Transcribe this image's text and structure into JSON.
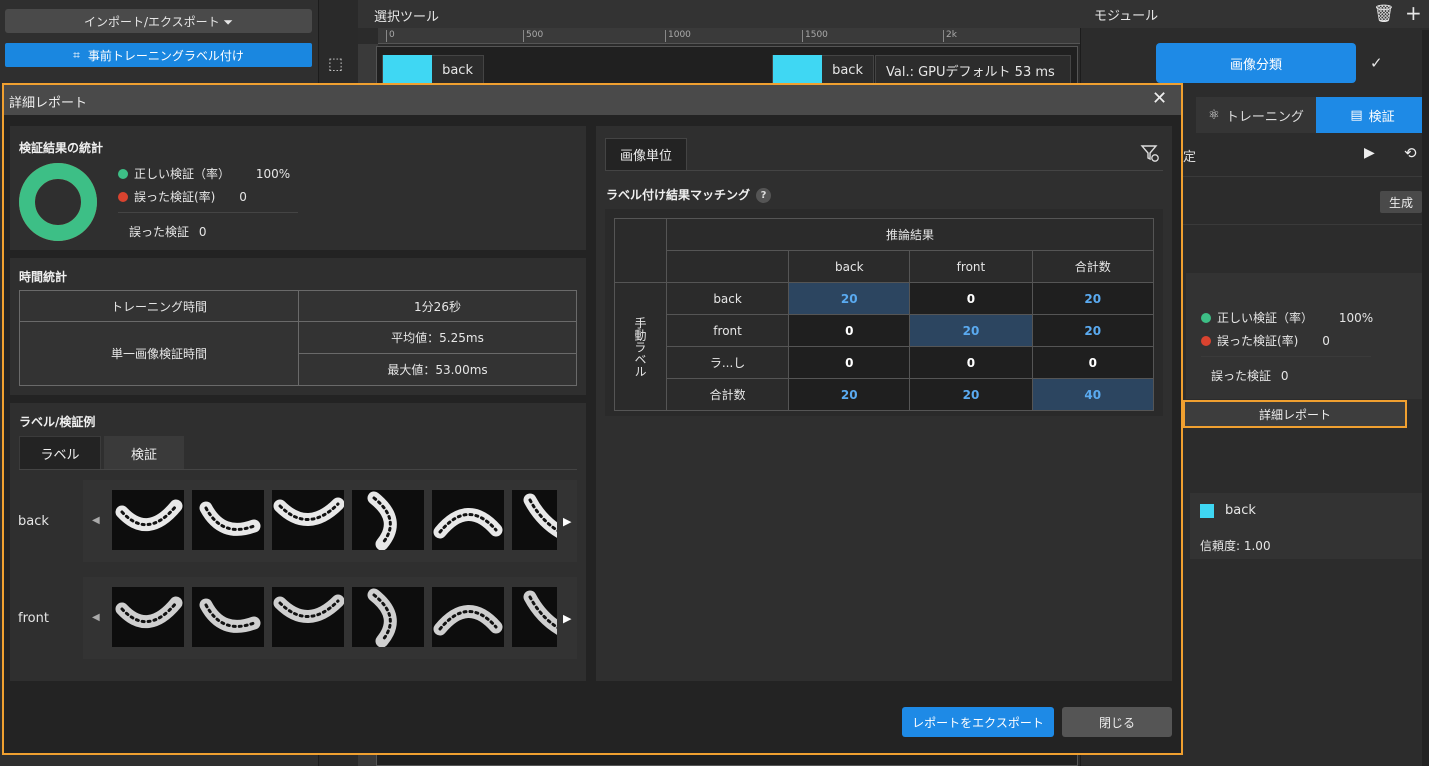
{
  "left": {
    "import_export": "インポート/エクスポート ⏷",
    "pretrain_label": "事前トレーニングラベル付け"
  },
  "canvas": {
    "header": "選択ツール",
    "ruler_ticks": [
      "0",
      "500",
      "1000",
      "1500",
      "2k"
    ],
    "tag1": "back",
    "tag2": "back",
    "val_text": "Val.: GPUデフォルト 53 ms"
  },
  "right": {
    "header": "モジュール",
    "classify_button": "画像分類",
    "tab_training": "トレーニング",
    "tab_verify": "検証",
    "settings_label": "定",
    "generate_button": "生成",
    "correct_label": "正しい検証（率）",
    "correct_value": "100%",
    "wrong_label": "誤った検証(率)",
    "wrong_value": "0",
    "wrong_count_label": "誤った検証",
    "wrong_count_value": "0",
    "detail_report_button": "詳細レポート",
    "result_label": "back",
    "confidence": "信頼度: 1.00"
  },
  "dialog": {
    "title": "詳細レポート",
    "stats": {
      "title": "検証結果の統計",
      "correct_label": "正しい検証（率）",
      "correct_value": "100%",
      "wrong_label": "誤った検証(率)",
      "wrong_value": "0",
      "wrong_count_label": "誤った検証",
      "wrong_count_value": "0",
      "correct_rate": 1.0,
      "colors": {
        "correct": "#3dbf86",
        "wrong": "#d9432f"
      }
    },
    "time": {
      "title": "時間統計",
      "training_label": "トレーニング時間",
      "training_value": "1分26秒",
      "single_label": "単一画像検証時間",
      "avg": "平均値：5.25ms",
      "max": "最大値：53.00ms"
    },
    "examples": {
      "title": "ラベル/検証例",
      "tabs": [
        "ラベル",
        "検証"
      ],
      "row1_label": "back",
      "row2_label": "front"
    },
    "match": {
      "tab": "画像単位",
      "title": "ラベル付け結果マッチング",
      "help": "?",
      "top_header": "推論結果",
      "side_header": "手動ラベル",
      "columns": [
        "back",
        "front",
        "合計数"
      ],
      "rows": [
        {
          "label": "back",
          "values": [
            "20",
            "0",
            "20"
          ]
        },
        {
          "label": "front",
          "values": [
            "0",
            "20",
            "20"
          ]
        },
        {
          "label": "ラ...し",
          "values": [
            "0",
            "0",
            "0"
          ]
        },
        {
          "label": "合計数",
          "values": [
            "20",
            "20",
            "40"
          ]
        }
      ]
    },
    "export_button": "レポートをエクスポート",
    "close_button": "閉じる"
  }
}
